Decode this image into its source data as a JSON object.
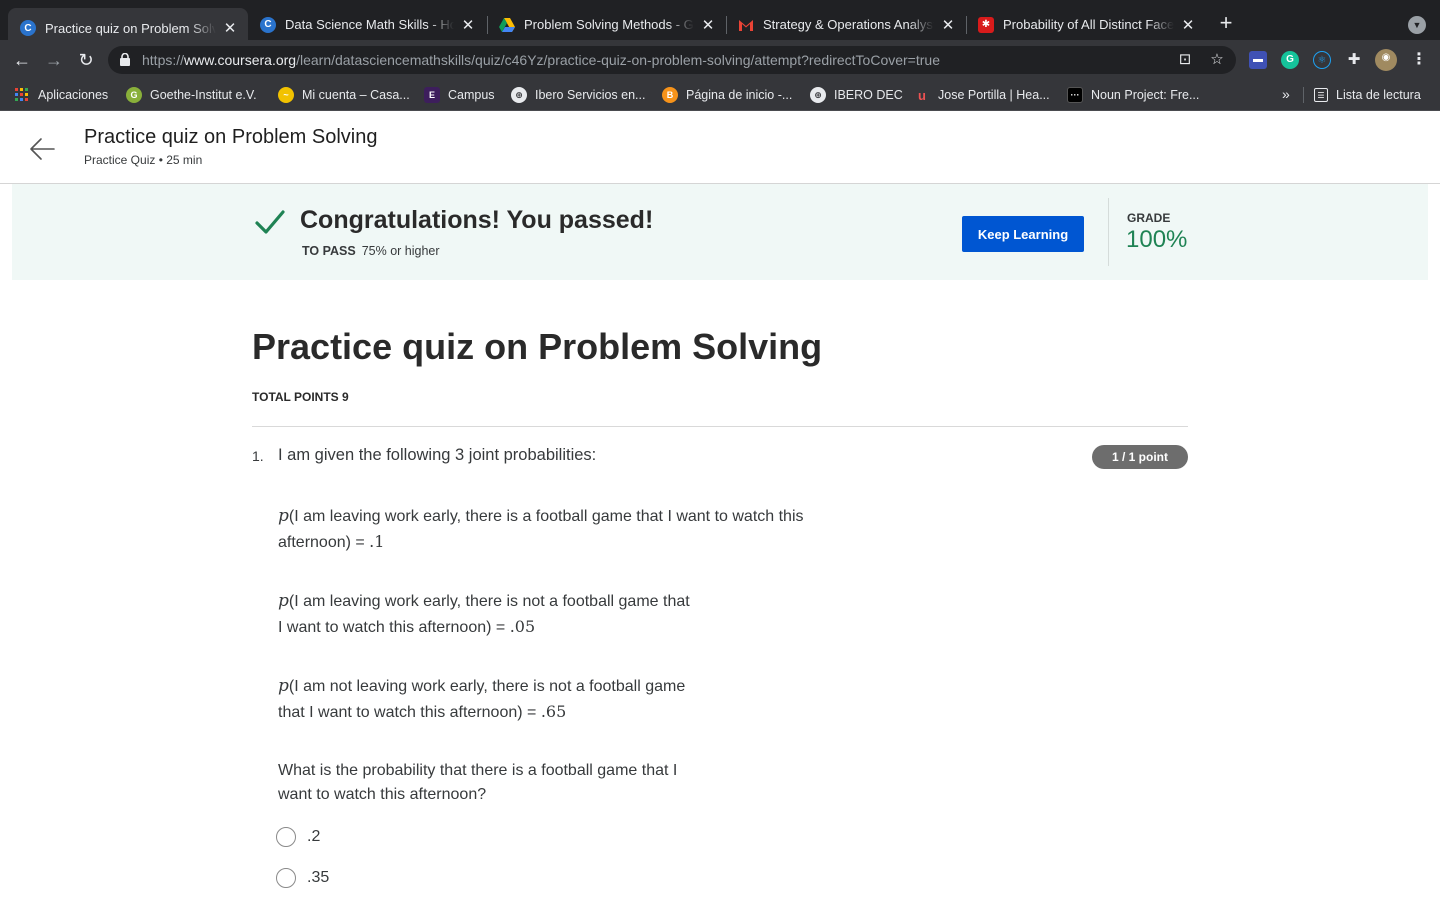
{
  "browser": {
    "tabs": [
      {
        "title": "Practice quiz on Problem Solvi",
        "favicon": "coursera-icon",
        "active": true
      },
      {
        "title": "Data Science Math Skills - Hom",
        "favicon": "coursera-icon",
        "active": false
      },
      {
        "title": "Problem Solving Methods - Go",
        "favicon": "google-drive-icon",
        "active": false
      },
      {
        "title": "Strategy & Operations Analyst",
        "favicon": "gmail-icon",
        "active": false
      },
      {
        "title": "Probability of All Distinct Faces",
        "favicon": "puzzle-icon",
        "active": false
      }
    ],
    "url_prefix": "https://",
    "url_domain": "www.coursera.org",
    "url_path": "/learn/datasciencemathskills/quiz/c46Yz/practice-quiz-on-problem-solving/attempt?redirectToCover=true",
    "bookmarks": [
      {
        "label": "Aplicaciones",
        "icon": "apps-grid-icon"
      },
      {
        "label": "Goethe-Institut e.V.",
        "icon": "goethe-icon"
      },
      {
        "label": "Mi cuenta – Casa...",
        "icon": "casa-icon"
      },
      {
        "label": "Campus",
        "icon": "campus-icon"
      },
      {
        "label": "Ibero Servicios en...",
        "icon": "globe-icon"
      },
      {
        "label": "Página de inicio -...",
        "icon": "bitcoin-icon"
      },
      {
        "label": "IBERO DEC",
        "icon": "globe-icon"
      },
      {
        "label": "Jose Portilla | Hea...",
        "icon": "udemy-icon"
      },
      {
        "label": "Noun Project: Fre...",
        "icon": "noun-project-icon"
      }
    ],
    "bookmarks_overflow": "»",
    "reading_list_label": "Lista de lectura"
  },
  "header": {
    "title": "Practice quiz on Problem Solving",
    "subtitle": "Practice Quiz • 25 min"
  },
  "result": {
    "message": "Congratulations! You passed!",
    "to_pass_label": "TO PASS",
    "to_pass_value": "75% or higher",
    "button_label": "Keep Learning",
    "grade_label": "GRADE",
    "grade_value": "100%",
    "colors": {
      "banner": "#f0f8f6",
      "button": "#0056d2",
      "grade": "#1f8354",
      "check": "#1f8354"
    }
  },
  "quiz": {
    "title": "Practice quiz on Problem Solving",
    "total_points": "TOTAL POINTS 9",
    "question": {
      "number": "1.",
      "text": "I am given the following 3 joint probabilities:",
      "points": "1 / 1 point",
      "probabilities": [
        {
          "symbol": "p",
          "line1": "(I am leaving work early, there is a football game that I want to watch this",
          "line2": "afternoon) = ",
          "value": ".1"
        },
        {
          "symbol": "p",
          "line1": "(I am leaving work early, there is not a football game that",
          "line2": "I want to watch this afternoon) = ",
          "value": ".05"
        },
        {
          "symbol": "p",
          "line1": "(I am not leaving work early, there is not a football game",
          "line2": "that I want to watch this afternoon) = ",
          "value": ".65"
        }
      ],
      "prompt_line1": "What is the probability that there is a football game that I",
      "prompt_line2": "want to watch this afternoon?",
      "options": [
        ".2",
        ".35"
      ]
    }
  }
}
